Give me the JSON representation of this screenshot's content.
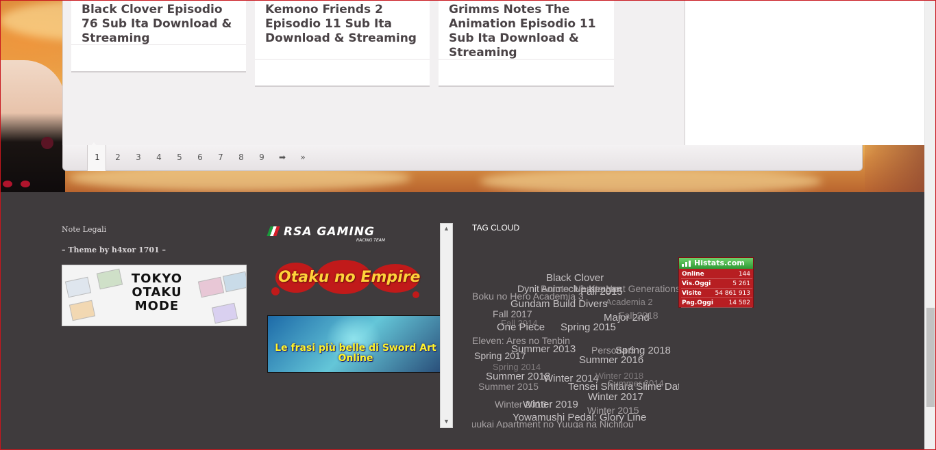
{
  "posts": [
    {
      "title": "Black Clover Episodio 76 Sub Ita Download & Streaming"
    },
    {
      "title": "Kemono Friends 2 Episodio 11 Sub Ita Download & Streaming"
    },
    {
      "title": "Grimms Notes The Animation Episodio 11 Sub Ita Download & Streaming"
    }
  ],
  "pagination": {
    "current": "1",
    "pages": [
      "2",
      "3",
      "4",
      "5",
      "6",
      "7",
      "8",
      "9"
    ],
    "next": "➡",
    "last": "»"
  },
  "footer": {
    "legal_title": "Note Legali",
    "theme_by": "– Theme by h4xor 1701 –",
    "tokyo_otaku_mode": {
      "line1": "TOKYO",
      "line2": "OTAKU",
      "line3": "MODE"
    },
    "rsa_gaming": {
      "name": "RSA GAMING",
      "sub": "RACING TEAM"
    },
    "otaku_empire": "Otaku no Empire",
    "sao_banner": "Le frasi più belle di Sword Art Online",
    "tag_cloud_title": "TAG CLOUD",
    "scroll_up": "▲",
    "scroll_down": "▼"
  },
  "tag_cloud": [
    {
      "text": "Black Clover",
      "size": 15
    },
    {
      "text": "Dynit Animeclub Kengan",
      "size": 14
    },
    {
      "text": "Boruto: Naruto Next Generations",
      "size": 14
    },
    {
      "text": "Fall 2015",
      "size": 15
    },
    {
      "text": "Boku no Hero Academia 3",
      "size": 14
    },
    {
      "text": "Academia 2",
      "size": 13
    },
    {
      "text": "Gundam Build Divers",
      "size": 15
    },
    {
      "text": "Fall 2017",
      "size": 14
    },
    {
      "text": "Major 2nd",
      "size": 15
    },
    {
      "text": "Fall 2018",
      "size": 14
    },
    {
      "text": "Fall 2014",
      "size": 13
    },
    {
      "text": "One Piece",
      "size": 15
    },
    {
      "text": "Spring 2015",
      "size": 15
    },
    {
      "text": "Eleven: Ares no Tenbin",
      "size": 14
    },
    {
      "text": "Summer 2013",
      "size": 15
    },
    {
      "text": "Persona 5",
      "size": 14
    },
    {
      "text": "Spring 2018",
      "size": 15
    },
    {
      "text": "Spring 2017",
      "size": 14
    },
    {
      "text": "Summer 2016",
      "size": 15
    },
    {
      "text": "Spring 2014",
      "size": 13
    },
    {
      "text": "Summer 2018",
      "size": 15
    },
    {
      "text": "Winter 2014",
      "size": 15
    },
    {
      "text": "Winter 2018",
      "size": 13
    },
    {
      "text": "Summer 2015",
      "size": 14
    },
    {
      "text": "Tensei Shitara Slime Datta Ken",
      "size": 15
    },
    {
      "text": "Summer 2014",
      "size": 13
    },
    {
      "text": "Winter 2017",
      "size": 15
    },
    {
      "text": "Winter 2016",
      "size": 14
    },
    {
      "text": "Winter 2019",
      "size": 15
    },
    {
      "text": "Winter 2015",
      "size": 14
    },
    {
      "text": "Yowamushi Pedal: Glory Line",
      "size": 15
    },
    {
      "text": "Yuukai Apartment no Yuuga na Nichijou",
      "size": 14
    }
  ],
  "histats": {
    "brand": "Histats.com",
    "rows": [
      {
        "label": "Online",
        "value": "144"
      },
      {
        "label": "Vis.Oggi",
        "value": "5 261"
      },
      {
        "label": "Visite",
        "value": "54 861 913"
      },
      {
        "label": "Pag.Oggi",
        "value": "14 582"
      }
    ]
  },
  "colors": {
    "footer_bg": "#3f3b3d",
    "frame_border": "#c8161d",
    "title_text": "#4a4346",
    "histats_red": "#b71e22"
  }
}
